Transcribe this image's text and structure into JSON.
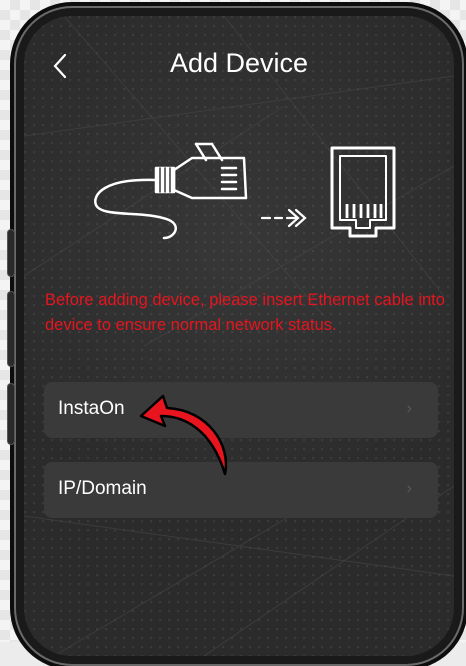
{
  "header": {
    "back_icon": "chevron-left-icon",
    "title": "Add Device"
  },
  "illustration": {
    "cable_icon": "ethernet-cable-icon",
    "arrow_icon": "dashed-arrow-icon",
    "port_icon": "ethernet-port-icon"
  },
  "warning_text": "Before adding device, please insert Ethernet cable into device to ensure normal network status.",
  "warning_color": "#e8141e",
  "menu": {
    "items": [
      {
        "label": "InstaOn",
        "chevron": "›"
      },
      {
        "label": "IP/Domain",
        "chevron": "›"
      }
    ]
  },
  "annotation": {
    "icon": "red-pointer-arrow-icon",
    "color": "#e8141e"
  }
}
